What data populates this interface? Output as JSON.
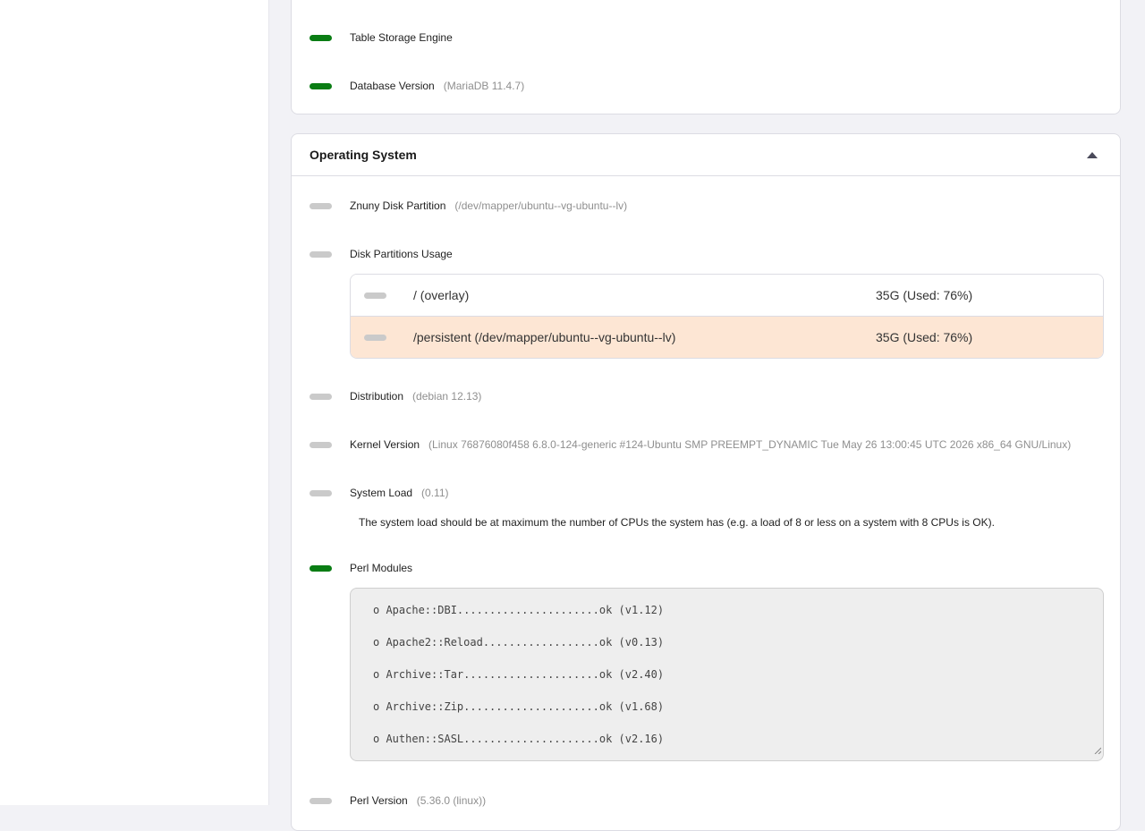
{
  "database_section": {
    "rows": [
      {
        "label": "Table Storage Engine",
        "value": "",
        "status": "ok"
      },
      {
        "label": "Database Version",
        "value": "(MariaDB 11.4.7)",
        "status": "ok"
      }
    ]
  },
  "os_section": {
    "title": "Operating System",
    "rows": {
      "disk_partition": {
        "label": "Znuny Disk Partition",
        "value": "(/dev/mapper/ubuntu--vg-ubuntu--lv)",
        "status": "neutral"
      },
      "disk_usage": {
        "label": "Disk Partitions Usage",
        "status": "neutral"
      },
      "distribution": {
        "label": "Distribution",
        "value": "(debian 12.13)",
        "status": "neutral"
      },
      "kernel": {
        "label": "Kernel Version",
        "value": "(Linux 76876080f458 6.8.0-124-generic #124-Ubuntu SMP PREEMPT_DYNAMIC Tue May 26 13:00:45 UTC 2026 x86_64 GNU/Linux)",
        "status": "neutral"
      },
      "system_load": {
        "label": "System Load",
        "value": "(0.11)",
        "status": "neutral",
        "note": "The system load should be at maximum the number of CPUs the system has (e.g. a load of 8 or less on a system with 8 CPUs is OK)."
      },
      "perl_modules": {
        "label": "Perl Modules",
        "status": "ok"
      },
      "perl_version": {
        "label": "Perl Version",
        "value": "(5.36.0 (linux))",
        "status": "neutral"
      }
    },
    "partitions": [
      {
        "name": "/ (overlay)",
        "size": "35G (Used: 76%)",
        "highlight": false
      },
      {
        "name": "/persistent (/dev/mapper/ubuntu--vg-ubuntu--lv)",
        "size": "35G (Used: 76%)",
        "highlight": true
      }
    ],
    "perl_module_lines": [
      "o Apache::DBI......................ok (v1.12)",
      "o Apache2::Reload..................ok (v0.13)",
      "o Archive::Tar.....................ok (v2.40)",
      "o Archive::Zip.....................ok (v1.68)",
      "o Authen::SASL.....................ok (v2.16)"
    ]
  },
  "icons": {
    "collapse": "chevron-up-icon",
    "resize": "resize-grip-icon"
  },
  "colors": {
    "ok": "#0a7d14",
    "neutral": "#cacaca",
    "highlight_row": "#fde6d4",
    "value_text": "#8f8f8f"
  }
}
